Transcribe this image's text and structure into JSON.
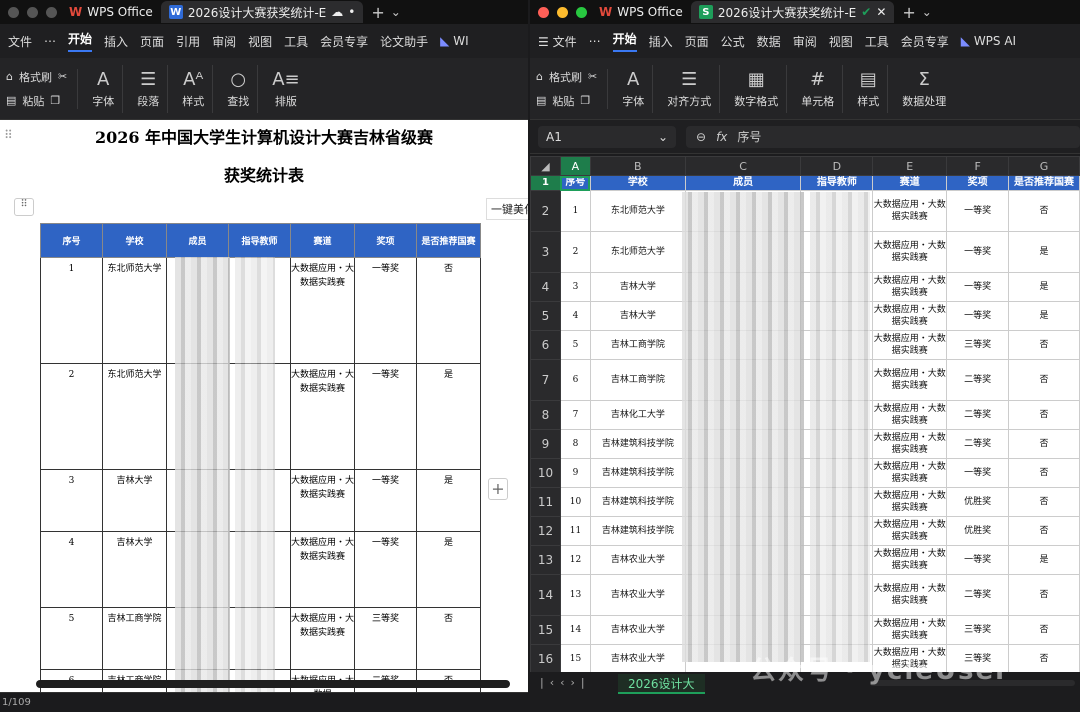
{
  "left": {
    "app_tab": "WPS Office",
    "doc_tab": "2026设计大赛获奖统计-E",
    "menu": [
      "文件",
      "开始",
      "插入",
      "页面",
      "引用",
      "审阅",
      "视图",
      "工具",
      "会员专享",
      "论文助手",
      "WI"
    ],
    "ribbon_small": [
      "格式刷",
      "粘贴"
    ],
    "ribbon": [
      "字体",
      "段落",
      "样式",
      "查找",
      "排版"
    ],
    "title1": "2026 年中国大学生计算机设计大赛吉林省级赛",
    "title2": "获奖统计表",
    "side_btn": "一键美化",
    "headers": [
      "序号",
      "学校",
      "成员",
      "指导教师",
      "赛道",
      "奖项",
      "是否推荐国赛"
    ],
    "rows": [
      {
        "no": "1",
        "school": "东北师范大学",
        "track": "大数据应用・大数据实践赛",
        "award": "一等奖",
        "rec": "否"
      },
      {
        "no": "2",
        "school": "东北师范大学",
        "track": "大数据应用・大数据实践赛",
        "award": "一等奖",
        "rec": "是"
      },
      {
        "no": "3",
        "school": "吉林大学",
        "track": "大数据应用・大数据实践赛",
        "award": "一等奖",
        "rec": "是"
      },
      {
        "no": "4",
        "school": "吉林大学",
        "track": "大数据应用・大数据实践赛",
        "award": "一等奖",
        "rec": "是"
      },
      {
        "no": "5",
        "school": "吉林工商学院",
        "track": "大数据应用・大数据实践赛",
        "award": "三等奖",
        "rec": "否"
      },
      {
        "no": "6",
        "school": "吉林工商学院",
        "track": "大数据应用・大数据",
        "award": "二等奖",
        "rec": "否"
      }
    ],
    "status": "1/109"
  },
  "right": {
    "app_tab": "WPS Office",
    "doc_tab": "2026设计大赛获奖统计-E",
    "menu": [
      "文件",
      "开始",
      "插入",
      "页面",
      "公式",
      "数据",
      "审阅",
      "视图",
      "工具",
      "会员专享",
      "WPS AI"
    ],
    "ribbon_small": [
      "格式刷",
      "粘贴"
    ],
    "ribbon": [
      "字体",
      "对齐方式",
      "数字格式",
      "单元格",
      "样式",
      "数据处理"
    ],
    "cell_ref": "A1",
    "fx_label": "fx",
    "formula": "序号",
    "columns": [
      "A",
      "B",
      "C",
      "D",
      "E",
      "F",
      "G"
    ],
    "headers": [
      "序号",
      "学校",
      "成员",
      "指导教师",
      "赛道",
      "奖项",
      "是否推荐国赛"
    ],
    "rows": [
      {
        "r": "2",
        "no": "1",
        "school": "东北师范大学",
        "track": "大数据应用・大数据实践赛",
        "award": "一等奖",
        "rec": "否"
      },
      {
        "r": "3",
        "no": "2",
        "school": "东北师范大学",
        "track": "大数据应用・大数据实践赛",
        "award": "一等奖",
        "rec": "是"
      },
      {
        "r": "4",
        "no": "3",
        "school": "吉林大学",
        "track": "大数据应用・大数据实践赛",
        "award": "一等奖",
        "rec": "是"
      },
      {
        "r": "5",
        "no": "4",
        "school": "吉林大学",
        "track": "大数据应用・大数据实践赛",
        "award": "一等奖",
        "rec": "是"
      },
      {
        "r": "6",
        "no": "5",
        "school": "吉林工商学院",
        "track": "大数据应用・大数据实践赛",
        "award": "三等奖",
        "rec": "否"
      },
      {
        "r": "7",
        "no": "6",
        "school": "吉林工商学院",
        "track": "大数据应用・大数据实践赛",
        "award": "二等奖",
        "rec": "否"
      },
      {
        "r": "8",
        "no": "7",
        "school": "吉林化工大学",
        "track": "大数据应用・大数据实践赛",
        "award": "二等奖",
        "rec": "否"
      },
      {
        "r": "9",
        "no": "8",
        "school": "吉林建筑科技学院",
        "track": "大数据应用・大数据实践赛",
        "award": "二等奖",
        "rec": "否"
      },
      {
        "r": "10",
        "no": "9",
        "school": "吉林建筑科技学院",
        "track": "大数据应用・大数据实践赛",
        "award": "一等奖",
        "rec": "否"
      },
      {
        "r": "11",
        "no": "10",
        "school": "吉林建筑科技学院",
        "track": "大数据应用・大数据实践赛",
        "award": "优胜奖",
        "rec": "否"
      },
      {
        "r": "12",
        "no": "11",
        "school": "吉林建筑科技学院",
        "track": "大数据应用・大数据实践赛",
        "award": "优胜奖",
        "rec": "否"
      },
      {
        "r": "13",
        "no": "12",
        "school": "吉林农业大学",
        "track": "大数据应用・大数据实践赛",
        "award": "一等奖",
        "rec": "是"
      },
      {
        "r": "14",
        "no": "13",
        "school": "吉林农业大学",
        "track": "大数据应用・大数据实践赛",
        "award": "二等奖",
        "rec": "否"
      },
      {
        "r": "15",
        "no": "14",
        "school": "吉林农业大学",
        "track": "大数据应用・大数据实践赛",
        "award": "三等奖",
        "rec": "否"
      },
      {
        "r": "16",
        "no": "15",
        "school": "吉林农业大学",
        "track": "大数据应用・大数据实践赛",
        "award": "三等奖",
        "rec": "否"
      }
    ],
    "sheet_tab": "2026设计大"
  },
  "watermark": "公众号 · ycleUser"
}
